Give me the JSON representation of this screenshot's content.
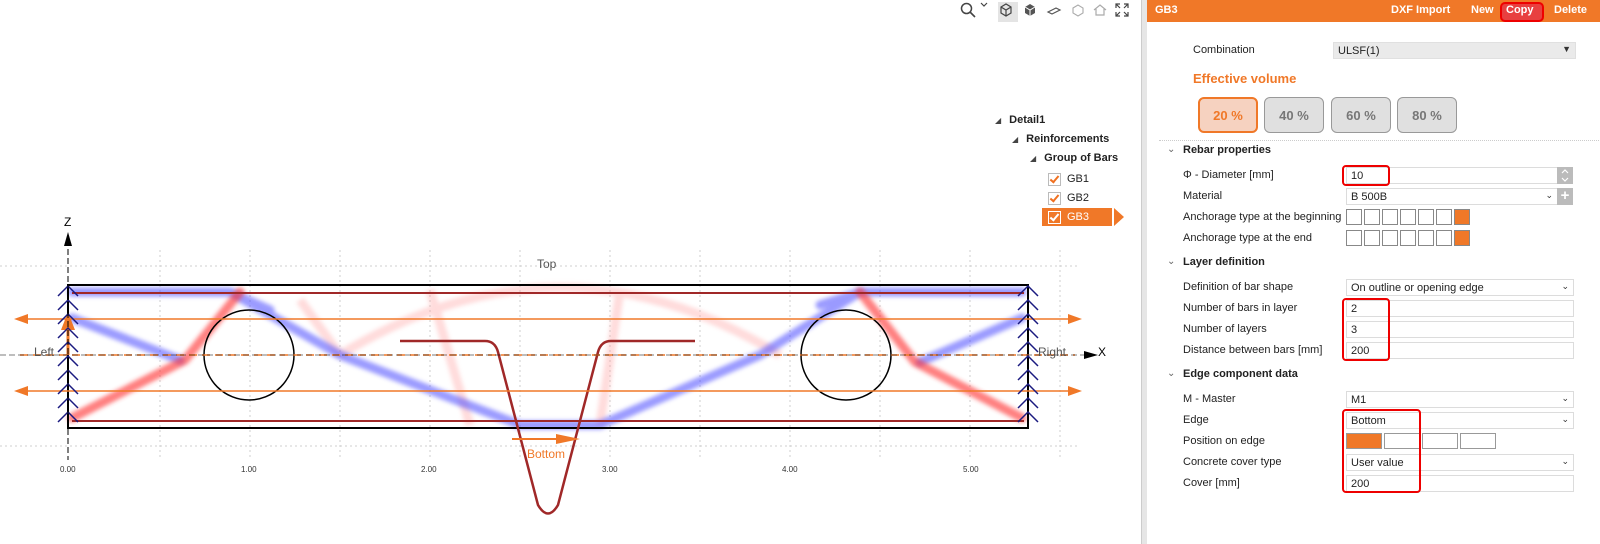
{
  "toolbar": {
    "icons": [
      "search-icon",
      "chevron-down-icon",
      "cube-wireframe-icon",
      "cube-solid-icon",
      "plane-icon",
      "wireframe-cube-icon",
      "home-icon",
      "fullscreen-icon"
    ]
  },
  "canvas": {
    "axis_z": "Z",
    "axis_x": "X",
    "label_top": "Top",
    "label_bottom": "Bottom",
    "label_left": "Left",
    "label_right": "Right",
    "ticks": [
      "0.00",
      "1.00",
      "2.00",
      "3.00",
      "4.00",
      "5.00"
    ]
  },
  "tree": {
    "root": "Detail1",
    "reinforcements": "Reinforcements",
    "group": "Group of Bars",
    "items": [
      "GB1",
      "GB2",
      "GB3"
    ],
    "selected": "GB3"
  },
  "panel": {
    "title": "GB3",
    "actions": {
      "dxf": "DXF Import",
      "new": "New",
      "copy": "Copy",
      "delete": "Delete"
    },
    "combination_label": "Combination",
    "combination_value": "ULSF(1)",
    "effective_volume_title": "Effective volume",
    "volumes": [
      "20 %",
      "40 %",
      "60 %",
      "80 %"
    ],
    "selected_volume": "20 %",
    "rebar_section": "Rebar properties",
    "diameter_label": "Φ - Diameter [mm]",
    "diameter_value": "10",
    "material_label": "Material",
    "material_value": "B 500B",
    "anch_begin_label": "Anchorage type at the beginning",
    "anch_end_label": "Anchorage type at the end",
    "layer_section": "Layer definition",
    "bar_shape_label": "Definition of bar shape",
    "bar_shape_value": "On outline or opening edge",
    "num_bars_label": "Number of bars in layer",
    "num_bars_value": "2",
    "num_layers_label": "Number of layers",
    "num_layers_value": "3",
    "distance_label": "Distance between bars [mm]",
    "distance_value": "200",
    "edge_section": "Edge component data",
    "master_label": "M - Master",
    "master_value": "M1",
    "edge_label": "Edge",
    "edge_value": "Bottom",
    "position_label": "Position on edge",
    "cover_type_label": "Concrete cover type",
    "cover_type_value": "User value",
    "cover_label": "Cover [mm]",
    "cover_value": "200"
  },
  "colors": {
    "accent": "#f07828",
    "highlight_red": "#e00000",
    "strut_blue": "#4a4aff",
    "tie_red": "#ff2a2a",
    "rebar": "#a02828",
    "support": "#1a1a80"
  }
}
